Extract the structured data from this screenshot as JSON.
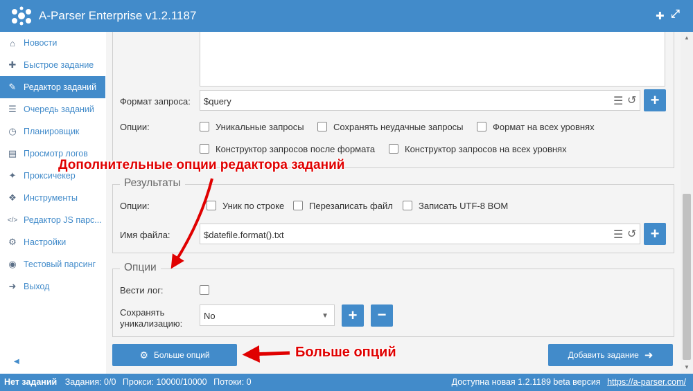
{
  "titlebar": {
    "title": "A-Parser Enterprise v1.2.1187",
    "pin_glyph": "✚",
    "expand_glyph": "⤢"
  },
  "sidebar": {
    "collapse_glyph": "◀",
    "items": [
      {
        "label": "Новости",
        "icon": "home-icon",
        "glyph": "⌂",
        "active": false
      },
      {
        "label": "Быстрое задание",
        "icon": "puzzle-icon",
        "glyph": "✚",
        "active": false
      },
      {
        "label": "Редактор заданий",
        "icon": "edit-icon",
        "glyph": "✎",
        "active": true
      },
      {
        "label": "Очередь заданий",
        "icon": "list-icon",
        "glyph": "☰",
        "active": false
      },
      {
        "label": "Планировщик",
        "icon": "clock-icon",
        "glyph": "◷",
        "active": false
      },
      {
        "label": "Просмотр логов",
        "icon": "file-icon",
        "glyph": "▤",
        "active": false
      },
      {
        "label": "Проксичекер",
        "icon": "plug-icon",
        "glyph": "✦",
        "active": false
      },
      {
        "label": "Инструменты",
        "icon": "tools-icon",
        "glyph": "❖",
        "active": false
      },
      {
        "label": "Редактор JS парс...",
        "icon": "code-icon",
        "glyph": "</>",
        "active": false
      },
      {
        "label": "Настройки",
        "icon": "gears-icon",
        "glyph": "⚙",
        "active": false
      },
      {
        "label": "Тестовый парсинг",
        "icon": "target-icon",
        "glyph": "◉",
        "active": false
      },
      {
        "label": "Выход",
        "icon": "exit-icon",
        "glyph": "➜",
        "active": false
      }
    ]
  },
  "query_section": {
    "format_label": "Формат запроса:",
    "format_value": "$query",
    "options_label": "Опции:",
    "checkboxes": [
      {
        "label": "Уникальные запросы",
        "checked": false
      },
      {
        "label": "Сохранять неудачные запросы",
        "checked": false
      },
      {
        "label": "Формат на всех уровнях",
        "checked": false
      },
      {
        "label": "Конструктор запросов после формата",
        "checked": false
      },
      {
        "label": "Конструктор запросов на всех уровнях",
        "checked": false
      }
    ]
  },
  "results_section": {
    "legend": "Результаты",
    "options_label": "Опции:",
    "checkboxes": [
      {
        "label": "Уник по строке",
        "checked": false
      },
      {
        "label": "Перезаписать файл",
        "checked": false
      },
      {
        "label": "Записать UTF-8 BOM",
        "checked": false
      }
    ],
    "filename_label": "Имя файла:",
    "filename_value": "$datefile.format().txt"
  },
  "options_section": {
    "legend": "Опции",
    "log_label": "Вести лог:",
    "log_checked": false,
    "save_unique_label_line1": "Сохранять",
    "save_unique_label_line2": "уникализацию:",
    "save_unique_value": "No"
  },
  "buttons": {
    "more_options": "Больше опций",
    "add_task": "Добавить задание",
    "plus_glyph": "+",
    "minus_glyph": "−",
    "gear_glyph": "⚙",
    "arrow_glyph": "➜",
    "list_glyph": "☰",
    "undo_glyph": "↺",
    "caret_glyph": "▼"
  },
  "annotations": {
    "editor_options": "Дополнительные опции редактора заданий",
    "more_options": "Больше опций"
  },
  "statusbar": {
    "no_tasks": "Нет заданий",
    "tasks": "Задания: 0/0",
    "proxies": "Прокси: 10000/10000",
    "threads": "Потоки: 0",
    "update": "Доступна новая 1.2.1189 beta версия",
    "link": "https://a-parser.com/"
  },
  "colors": {
    "accent": "#428bca",
    "annotation": "#e00000",
    "background": "#f4f4f4"
  }
}
